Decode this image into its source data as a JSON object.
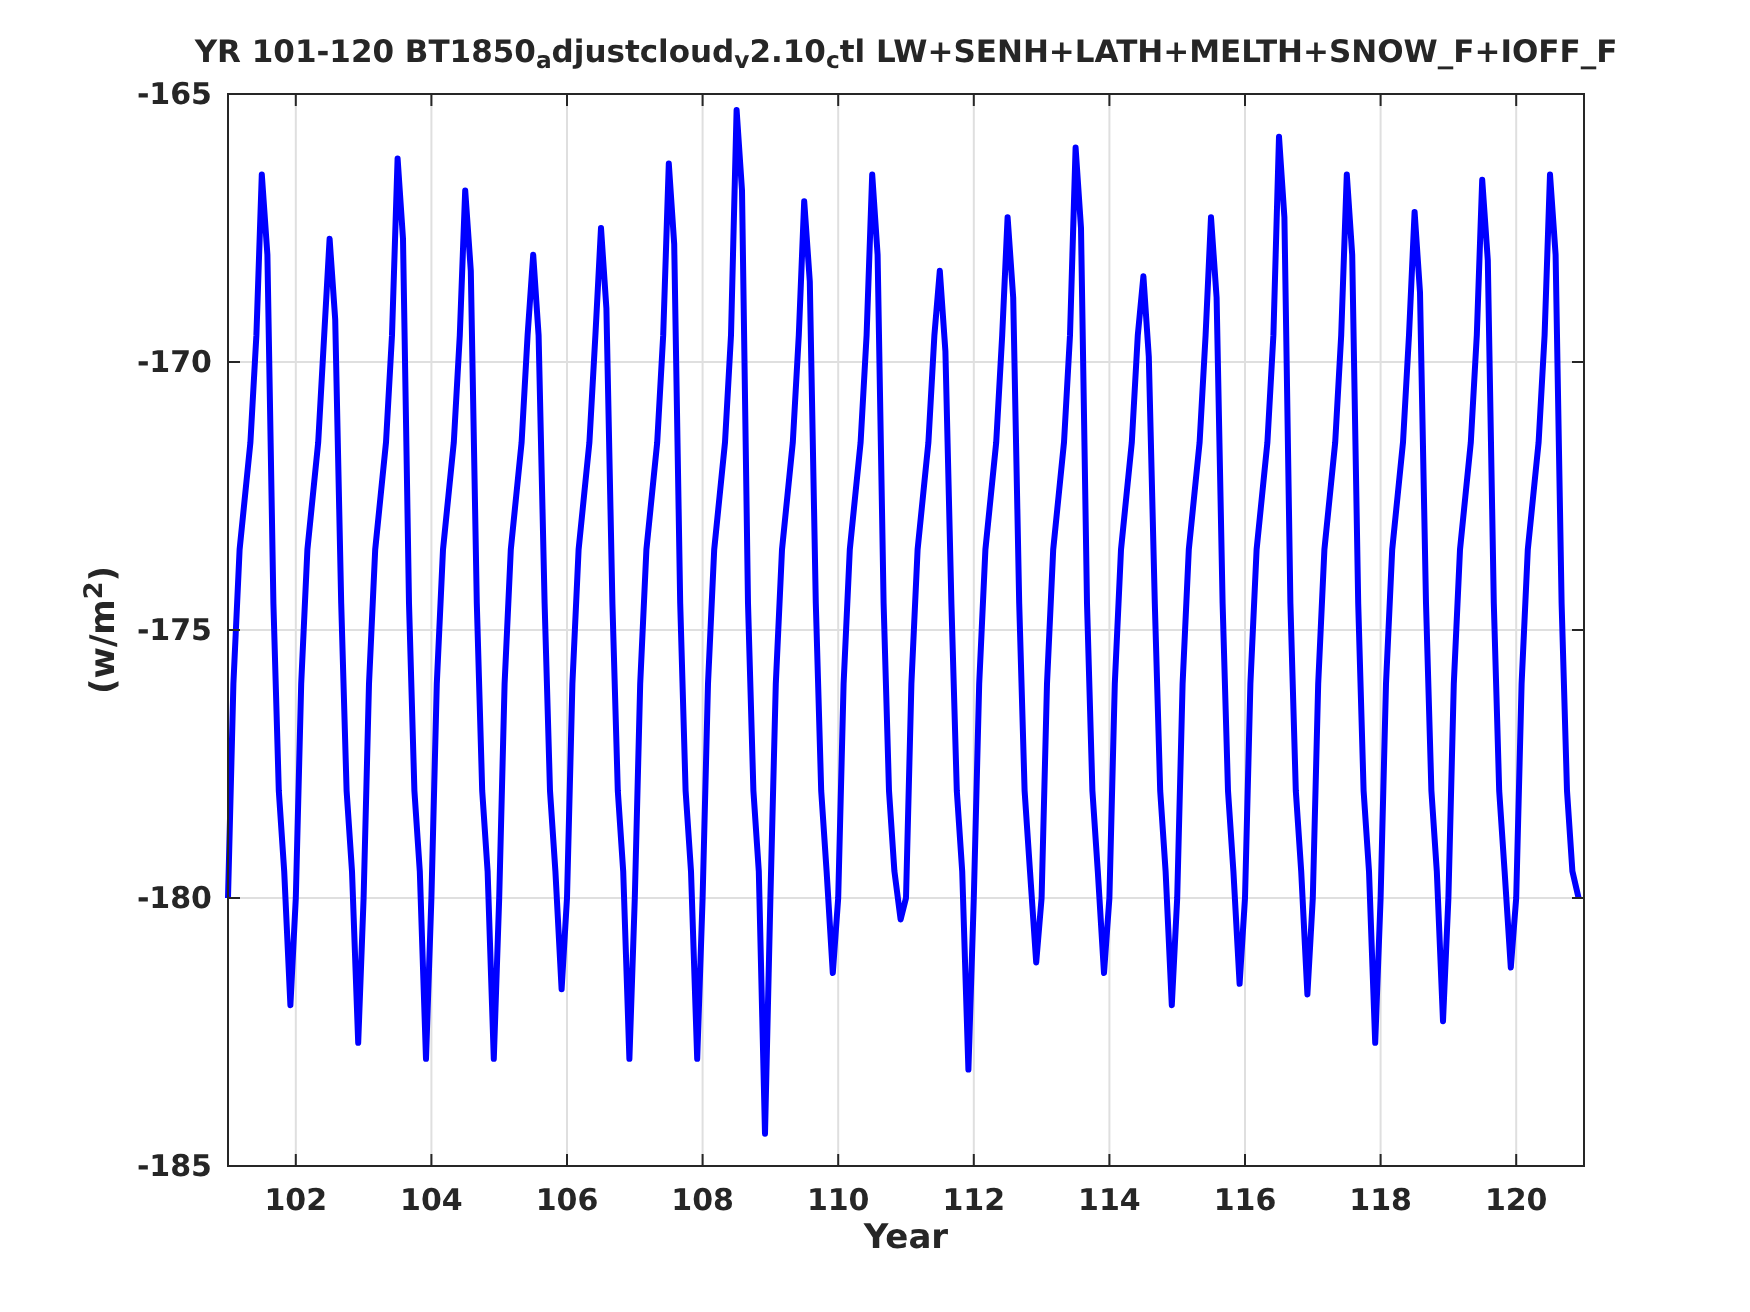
{
  "figure": {
    "chart_data": {
      "type": "line",
      "title": "YR 101-120 BT1850$_{a}$djustcloud$_{v}$2.10$_{c}$tl LW+SENH+LATH+MELTH+SNOW_F+IOFF_F",
      "xlabel": "Year",
      "ylabel": "(w/m$^{2}$)",
      "xlim": [
        101,
        121
      ],
      "ylim": [
        -185,
        -165
      ],
      "xticks": [
        102,
        104,
        106,
        108,
        110,
        112,
        114,
        116,
        118,
        120
      ],
      "yticks": [
        -185,
        -180,
        -175,
        -170,
        -165
      ],
      "grid": true,
      "x": [
        101,
        101.08,
        101.17,
        101.25,
        101.33,
        101.42,
        101.5,
        101.58,
        101.67,
        101.75,
        101.83,
        101.92,
        102,
        102.08,
        102.17,
        102.25,
        102.33,
        102.42,
        102.5,
        102.58,
        102.67,
        102.75,
        102.83,
        102.92,
        103,
        103.08,
        103.17,
        103.25,
        103.33,
        103.42,
        103.5,
        103.58,
        103.67,
        103.75,
        103.83,
        103.92,
        104,
        104.08,
        104.17,
        104.25,
        104.33,
        104.42,
        104.5,
        104.58,
        104.67,
        104.75,
        104.83,
        104.92,
        105,
        105.08,
        105.17,
        105.25,
        105.33,
        105.42,
        105.5,
        105.58,
        105.67,
        105.75,
        105.83,
        105.92,
        106,
        106.08,
        106.17,
        106.25,
        106.33,
        106.42,
        106.5,
        106.58,
        106.67,
        106.75,
        106.83,
        106.92,
        107,
        107.08,
        107.17,
        107.25,
        107.33,
        107.42,
        107.5,
        107.58,
        107.67,
        107.75,
        107.83,
        107.92,
        108,
        108.08,
        108.17,
        108.25,
        108.33,
        108.42,
        108.5,
        108.58,
        108.67,
        108.75,
        108.83,
        108.92,
        109,
        109.08,
        109.17,
        109.25,
        109.33,
        109.42,
        109.5,
        109.58,
        109.67,
        109.75,
        109.83,
        109.92,
        110,
        110.08,
        110.17,
        110.25,
        110.33,
        110.42,
        110.5,
        110.58,
        110.67,
        110.75,
        110.83,
        110.92,
        111,
        111.08,
        111.17,
        111.25,
        111.33,
        111.42,
        111.5,
        111.58,
        111.67,
        111.75,
        111.83,
        111.92,
        112,
        112.08,
        112.17,
        112.25,
        112.33,
        112.42,
        112.5,
        112.58,
        112.67,
        112.75,
        112.83,
        112.92,
        113,
        113.08,
        113.17,
        113.25,
        113.33,
        113.42,
        113.5,
        113.58,
        113.67,
        113.75,
        113.83,
        113.92,
        114,
        114.08,
        114.17,
        114.25,
        114.33,
        114.42,
        114.5,
        114.58,
        114.67,
        114.75,
        114.83,
        114.92,
        115,
        115.08,
        115.17,
        115.25,
        115.33,
        115.42,
        115.5,
        115.58,
        115.67,
        115.75,
        115.83,
        115.92,
        116,
        116.08,
        116.17,
        116.25,
        116.33,
        116.42,
        116.5,
        116.58,
        116.67,
        116.75,
        116.83,
        116.92,
        117,
        117.08,
        117.17,
        117.25,
        117.33,
        117.42,
        117.5,
        117.58,
        117.67,
        117.75,
        117.83,
        117.92,
        118,
        118.08,
        118.17,
        118.25,
        118.33,
        118.42,
        118.5,
        118.58,
        118.67,
        118.75,
        118.83,
        118.92,
        119,
        119.08,
        119.17,
        119.25,
        119.33,
        119.42,
        119.5,
        119.58,
        119.67,
        119.75,
        119.83,
        119.92,
        120,
        120.08,
        120.17,
        120.25,
        120.33,
        120.42,
        120.5,
        120.58,
        120.67,
        120.75,
        120.83,
        120.92
      ],
      "series": [
        {
          "color": "#0000ff",
          "values": [
            -180,
            -176,
            -173.5,
            -172.5,
            -171.5,
            -169.5,
            -166.5,
            -168,
            -174.5,
            -178,
            -179.5,
            -182,
            -180,
            -176,
            -173.5,
            -172.5,
            -171.5,
            -169.5,
            -167.7,
            -169.2,
            -174.5,
            -178,
            -179.5,
            -182.7,
            -180,
            -176,
            -173.5,
            -172.5,
            -171.5,
            -169.5,
            -166.2,
            -167.7,
            -174.5,
            -178,
            -179.5,
            -183,
            -180,
            -176,
            -173.5,
            -172.5,
            -171.5,
            -169.5,
            -166.8,
            -168.3,
            -174.5,
            -178,
            -179.5,
            -183,
            -180,
            -176,
            -173.5,
            -172.5,
            -171.5,
            -169.5,
            -168,
            -169.5,
            -174.5,
            -178,
            -179.5,
            -181.7,
            -180,
            -176,
            -173.5,
            -172.5,
            -171.5,
            -169.5,
            -167.5,
            -169,
            -174.5,
            -178,
            -179.5,
            -183,
            -180,
            -176,
            -173.5,
            -172.5,
            -171.5,
            -169.5,
            -166.3,
            -167.8,
            -174.5,
            -178,
            -179.5,
            -183,
            -180,
            -176,
            -173.5,
            -172.5,
            -171.5,
            -169.5,
            -165.3,
            -166.8,
            -174.5,
            -178,
            -179.5,
            -184.4,
            -180,
            -176,
            -173.5,
            -172.5,
            -171.5,
            -169.5,
            -167,
            -168.5,
            -174.5,
            -178,
            -179.5,
            -181.4,
            -180,
            -176,
            -173.5,
            -172.5,
            -171.5,
            -169.5,
            -166.5,
            -168,
            -174.5,
            -178,
            -179.5,
            -180.4,
            -180,
            -176,
            -173.5,
            -172.5,
            -171.5,
            -169.5,
            -168.3,
            -169.8,
            -174.5,
            -178,
            -179.5,
            -183.2,
            -180,
            -176,
            -173.5,
            -172.5,
            -171.5,
            -169.5,
            -167.3,
            -168.8,
            -174.5,
            -178,
            -179.5,
            -181.2,
            -180,
            -176,
            -173.5,
            -172.5,
            -171.5,
            -169.5,
            -166,
            -167.5,
            -174.5,
            -178,
            -179.5,
            -181.4,
            -180,
            -176,
            -173.5,
            -172.5,
            -171.5,
            -169.5,
            -168.4,
            -169.9,
            -174.5,
            -178,
            -179.5,
            -182,
            -180,
            -176,
            -173.5,
            -172.5,
            -171.5,
            -169.5,
            -167.3,
            -168.8,
            -174.5,
            -178,
            -179.5,
            -181.6,
            -180,
            -176,
            -173.5,
            -172.5,
            -171.5,
            -169.5,
            -165.8,
            -167.3,
            -174.5,
            -178,
            -179.5,
            -181.8,
            -180,
            -176,
            -173.5,
            -172.5,
            -171.5,
            -169.5,
            -166.5,
            -168,
            -174.5,
            -178,
            -179.5,
            -182.7,
            -180,
            -176,
            -173.5,
            -172.5,
            -171.5,
            -169.5,
            -167.2,
            -168.7,
            -174.5,
            -178,
            -179.5,
            -182.3,
            -180,
            -176,
            -173.5,
            -172.5,
            -171.5,
            -169.5,
            -166.6,
            -168.1,
            -174.5,
            -178,
            -179.5,
            -181.3,
            -180,
            -176,
            -173.5,
            -172.5,
            -171.5,
            -169.5,
            -166.5,
            -168,
            -174.5,
            -178,
            -179.5,
            -180
          ]
        }
      ]
    }
  }
}
